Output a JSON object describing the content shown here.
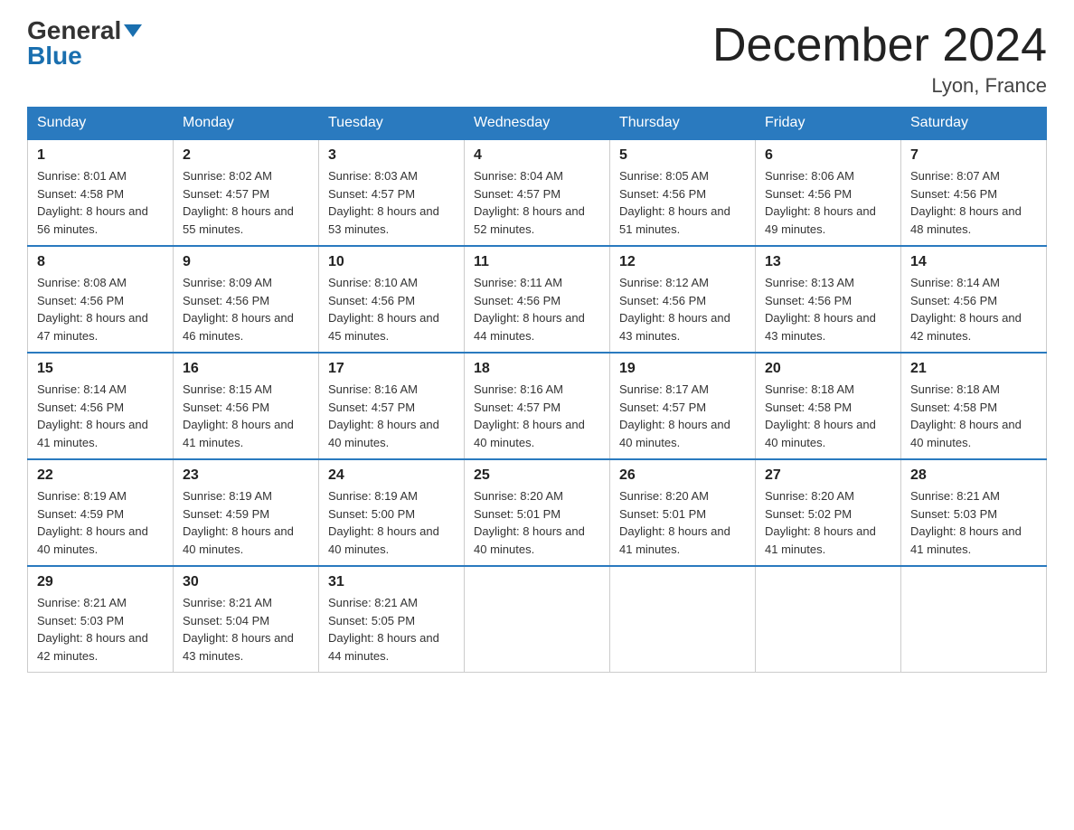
{
  "header": {
    "logo_general": "General",
    "logo_blue": "Blue",
    "month_title": "December 2024",
    "location": "Lyon, France"
  },
  "weekdays": [
    "Sunday",
    "Monday",
    "Tuesday",
    "Wednesday",
    "Thursday",
    "Friday",
    "Saturday"
  ],
  "weeks": [
    [
      {
        "day": "1",
        "sunrise": "Sunrise: 8:01 AM",
        "sunset": "Sunset: 4:58 PM",
        "daylight": "Daylight: 8 hours and 56 minutes."
      },
      {
        "day": "2",
        "sunrise": "Sunrise: 8:02 AM",
        "sunset": "Sunset: 4:57 PM",
        "daylight": "Daylight: 8 hours and 55 minutes."
      },
      {
        "day": "3",
        "sunrise": "Sunrise: 8:03 AM",
        "sunset": "Sunset: 4:57 PM",
        "daylight": "Daylight: 8 hours and 53 minutes."
      },
      {
        "day": "4",
        "sunrise": "Sunrise: 8:04 AM",
        "sunset": "Sunset: 4:57 PM",
        "daylight": "Daylight: 8 hours and 52 minutes."
      },
      {
        "day": "5",
        "sunrise": "Sunrise: 8:05 AM",
        "sunset": "Sunset: 4:56 PM",
        "daylight": "Daylight: 8 hours and 51 minutes."
      },
      {
        "day": "6",
        "sunrise": "Sunrise: 8:06 AM",
        "sunset": "Sunset: 4:56 PM",
        "daylight": "Daylight: 8 hours and 49 minutes."
      },
      {
        "day": "7",
        "sunrise": "Sunrise: 8:07 AM",
        "sunset": "Sunset: 4:56 PM",
        "daylight": "Daylight: 8 hours and 48 minutes."
      }
    ],
    [
      {
        "day": "8",
        "sunrise": "Sunrise: 8:08 AM",
        "sunset": "Sunset: 4:56 PM",
        "daylight": "Daylight: 8 hours and 47 minutes."
      },
      {
        "day": "9",
        "sunrise": "Sunrise: 8:09 AM",
        "sunset": "Sunset: 4:56 PM",
        "daylight": "Daylight: 8 hours and 46 minutes."
      },
      {
        "day": "10",
        "sunrise": "Sunrise: 8:10 AM",
        "sunset": "Sunset: 4:56 PM",
        "daylight": "Daylight: 8 hours and 45 minutes."
      },
      {
        "day": "11",
        "sunrise": "Sunrise: 8:11 AM",
        "sunset": "Sunset: 4:56 PM",
        "daylight": "Daylight: 8 hours and 44 minutes."
      },
      {
        "day": "12",
        "sunrise": "Sunrise: 8:12 AM",
        "sunset": "Sunset: 4:56 PM",
        "daylight": "Daylight: 8 hours and 43 minutes."
      },
      {
        "day": "13",
        "sunrise": "Sunrise: 8:13 AM",
        "sunset": "Sunset: 4:56 PM",
        "daylight": "Daylight: 8 hours and 43 minutes."
      },
      {
        "day": "14",
        "sunrise": "Sunrise: 8:14 AM",
        "sunset": "Sunset: 4:56 PM",
        "daylight": "Daylight: 8 hours and 42 minutes."
      }
    ],
    [
      {
        "day": "15",
        "sunrise": "Sunrise: 8:14 AM",
        "sunset": "Sunset: 4:56 PM",
        "daylight": "Daylight: 8 hours and 41 minutes."
      },
      {
        "day": "16",
        "sunrise": "Sunrise: 8:15 AM",
        "sunset": "Sunset: 4:56 PM",
        "daylight": "Daylight: 8 hours and 41 minutes."
      },
      {
        "day": "17",
        "sunrise": "Sunrise: 8:16 AM",
        "sunset": "Sunset: 4:57 PM",
        "daylight": "Daylight: 8 hours and 40 minutes."
      },
      {
        "day": "18",
        "sunrise": "Sunrise: 8:16 AM",
        "sunset": "Sunset: 4:57 PM",
        "daylight": "Daylight: 8 hours and 40 minutes."
      },
      {
        "day": "19",
        "sunrise": "Sunrise: 8:17 AM",
        "sunset": "Sunset: 4:57 PM",
        "daylight": "Daylight: 8 hours and 40 minutes."
      },
      {
        "day": "20",
        "sunrise": "Sunrise: 8:18 AM",
        "sunset": "Sunset: 4:58 PM",
        "daylight": "Daylight: 8 hours and 40 minutes."
      },
      {
        "day": "21",
        "sunrise": "Sunrise: 8:18 AM",
        "sunset": "Sunset: 4:58 PM",
        "daylight": "Daylight: 8 hours and 40 minutes."
      }
    ],
    [
      {
        "day": "22",
        "sunrise": "Sunrise: 8:19 AM",
        "sunset": "Sunset: 4:59 PM",
        "daylight": "Daylight: 8 hours and 40 minutes."
      },
      {
        "day": "23",
        "sunrise": "Sunrise: 8:19 AM",
        "sunset": "Sunset: 4:59 PM",
        "daylight": "Daylight: 8 hours and 40 minutes."
      },
      {
        "day": "24",
        "sunrise": "Sunrise: 8:19 AM",
        "sunset": "Sunset: 5:00 PM",
        "daylight": "Daylight: 8 hours and 40 minutes."
      },
      {
        "day": "25",
        "sunrise": "Sunrise: 8:20 AM",
        "sunset": "Sunset: 5:01 PM",
        "daylight": "Daylight: 8 hours and 40 minutes."
      },
      {
        "day": "26",
        "sunrise": "Sunrise: 8:20 AM",
        "sunset": "Sunset: 5:01 PM",
        "daylight": "Daylight: 8 hours and 41 minutes."
      },
      {
        "day": "27",
        "sunrise": "Sunrise: 8:20 AM",
        "sunset": "Sunset: 5:02 PM",
        "daylight": "Daylight: 8 hours and 41 minutes."
      },
      {
        "day": "28",
        "sunrise": "Sunrise: 8:21 AM",
        "sunset": "Sunset: 5:03 PM",
        "daylight": "Daylight: 8 hours and 41 minutes."
      }
    ],
    [
      {
        "day": "29",
        "sunrise": "Sunrise: 8:21 AM",
        "sunset": "Sunset: 5:03 PM",
        "daylight": "Daylight: 8 hours and 42 minutes."
      },
      {
        "day": "30",
        "sunrise": "Sunrise: 8:21 AM",
        "sunset": "Sunset: 5:04 PM",
        "daylight": "Daylight: 8 hours and 43 minutes."
      },
      {
        "day": "31",
        "sunrise": "Sunrise: 8:21 AM",
        "sunset": "Sunset: 5:05 PM",
        "daylight": "Daylight: 8 hours and 44 minutes."
      },
      null,
      null,
      null,
      null
    ]
  ]
}
